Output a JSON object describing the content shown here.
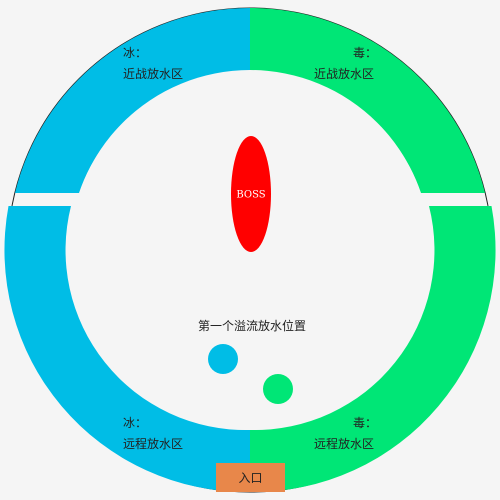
{
  "zones": {
    "top_left": {
      "title": "冰：",
      "subtitle": "近战放水区",
      "color": "#00bde6"
    },
    "top_right": {
      "title": "毒：",
      "subtitle": "近战放水区",
      "color": "#00e676"
    },
    "bottom_left": {
      "title": "冰：",
      "subtitle": "远程放水区",
      "color": "#00bde6"
    },
    "bottom_right": {
      "title": "毒：",
      "subtitle": "远程放水区",
      "color": "#00e676"
    }
  },
  "boss": {
    "label": "BOSS",
    "color": "#ff0000"
  },
  "overflow": {
    "label": "第一个溢流放水位置"
  },
  "markers": {
    "ice_color": "#00bde6",
    "poison_color": "#00e676"
  },
  "entry": {
    "label": "入口",
    "color": "#e8874a"
  },
  "center_color": "#f5f5f5"
}
